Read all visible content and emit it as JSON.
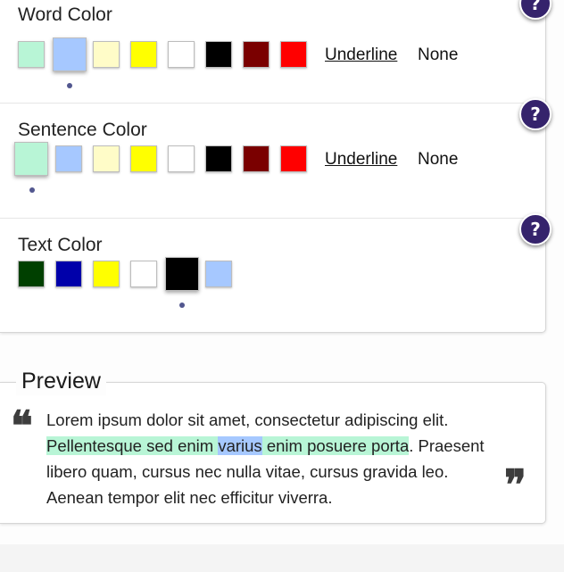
{
  "sections": {
    "word_color": {
      "title": "Word Color",
      "swatches": [
        "#b8f5d6",
        "#a6c8ff",
        "#fffcc8",
        "#ffff00",
        "#ffffff",
        "#000000",
        "#7a0000",
        "#ff0000"
      ],
      "selected_index": 1,
      "underline_label": "Underline",
      "none_label": "None"
    },
    "sentence_color": {
      "title": "Sentence Color",
      "swatches": [
        "#b8f5d6",
        "#a6c8ff",
        "#fffcc8",
        "#ffff00",
        "#ffffff",
        "#000000",
        "#7a0000",
        "#ff0000"
      ],
      "selected_index": 0,
      "underline_label": "Underline",
      "none_label": "None"
    },
    "text_color": {
      "title": "Text Color",
      "swatches": [
        "#004000",
        "#0000aa",
        "#ffff00",
        "#ffffff",
        "#000000",
        "#a6c8ff"
      ],
      "selected_index": 4
    }
  },
  "help_icon_label": "?",
  "preview": {
    "legend": "Preview",
    "open_quote": "❝",
    "close_quote": "❞",
    "text_part1": "Lorem ipsum dolor sit amet, consectetur adipiscing elit.",
    "sentence_before_word": "Pellentesque sed enim ",
    "highlighted_word": "varius",
    "sentence_after_word": " enim posuere porta",
    "text_part2": ". Praesent libero quam, cursus nec nulla vitae, cursus gravida leo. Aenean tempor elit nec efficitur viverra."
  },
  "colors": {
    "help_button": "#35236c",
    "selection_dot": "#52578f",
    "sentence_highlight": "#b8f5d6",
    "word_highlight": "#a6c8ff"
  }
}
